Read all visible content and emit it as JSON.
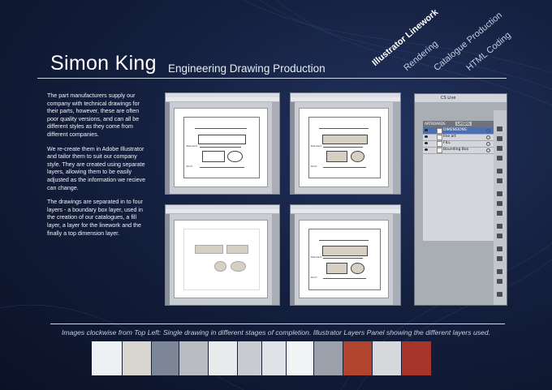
{
  "header": {
    "name": "Simon King",
    "subtitle": "Engineering Drawing Production"
  },
  "nav": [
    {
      "label": "Illustrator Linework",
      "active": true
    },
    {
      "label": "Rendering",
      "active": false
    },
    {
      "label": "Catalogue Production",
      "active": false
    },
    {
      "label": "HTML Coding",
      "active": false
    }
  ],
  "body": {
    "p1": "The part manufacturers supply our company with technical drawings for their parts, however, these are often poor quality versions, and can all be different styles as they come from different companies.",
    "p2": "We re-create them in Adobe Illustrator and tailor them to suit our company style. They are created using separate layers, allowing them to be easily adjusted as the information we recieve can change.",
    "p3": "The drawings are separated in to four layers - a boundary box layer, used in the creation of our catalogues, a fill layer, a layer for the linework and the finally a top dimension layer."
  },
  "layers_panel": {
    "cs_live": "CS Live",
    "tabs": [
      "ARTBOARDS",
      "LAYERS"
    ],
    "rows": [
      "DIMENSIONS",
      "line art",
      "FILL",
      "Bounding Box"
    ]
  },
  "drawing_labels": {
    "standard": "Standard",
    "short": "Short"
  },
  "caption": "Images clockwise from Top Left: Single drawing in different stages of completion. Illustrator Layers Panel showing the different layers used.",
  "colors": {
    "accent": "#4a6fb5",
    "background": "#14203f"
  }
}
